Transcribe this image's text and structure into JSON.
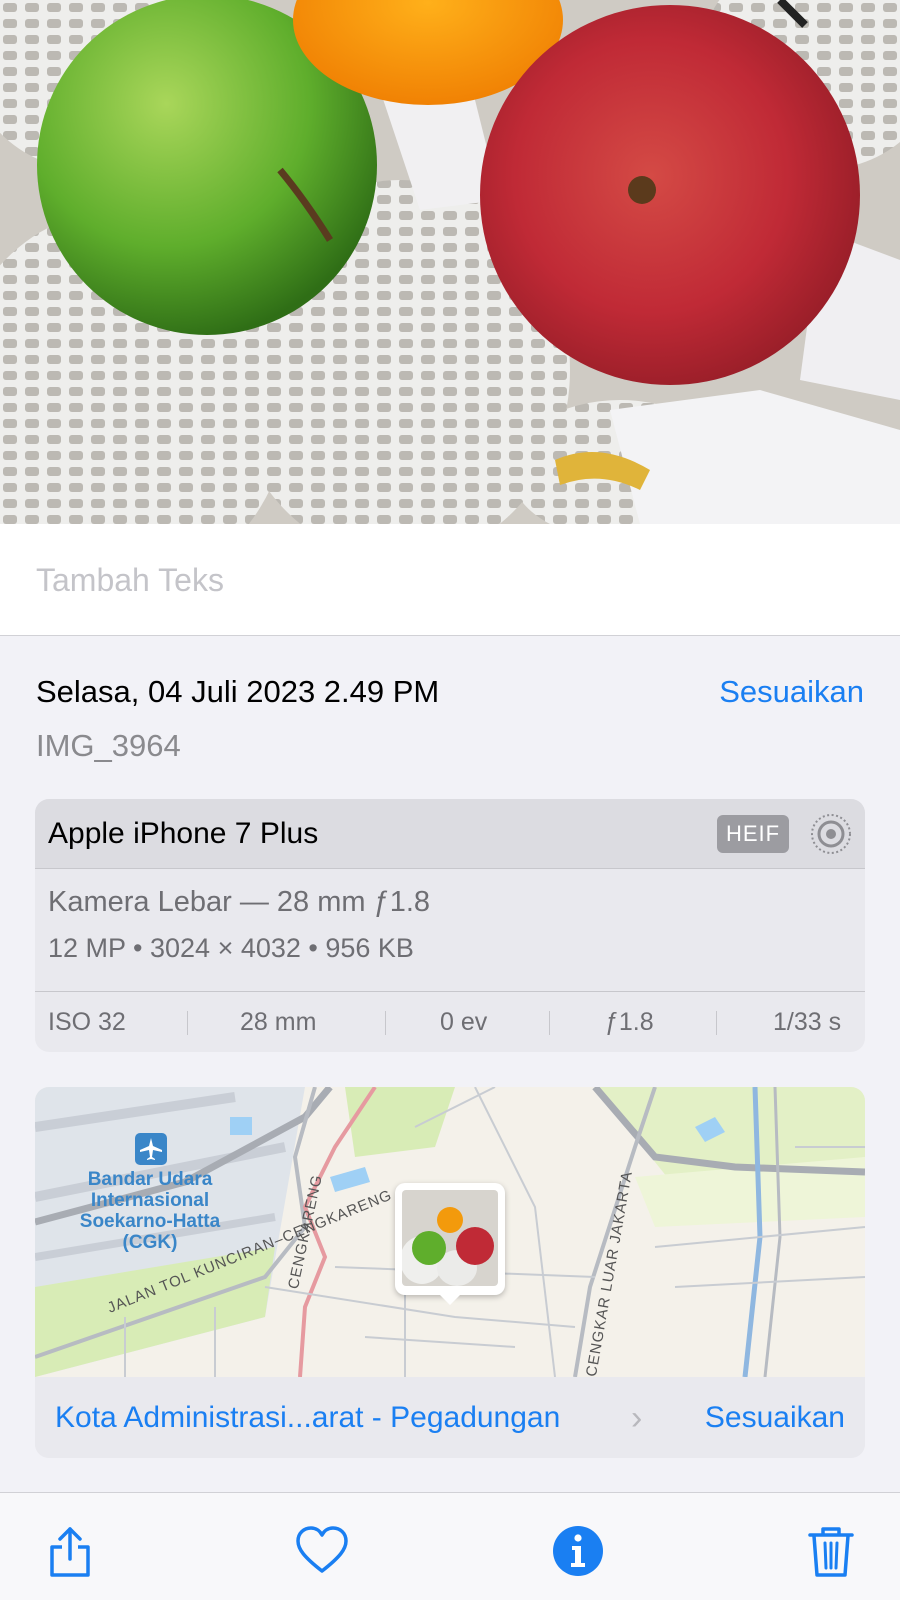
{
  "caption": {
    "placeholder": "Tambah Teks"
  },
  "header": {
    "date": "Selasa, 04 Juli 2023 2.49 PM",
    "adjust_label": "Sesuaikan",
    "filename": "IMG_3964"
  },
  "camera": {
    "device": "Apple iPhone 7 Plus",
    "format_badge": "HEIF",
    "lens": "Kamera Lebar — 28 mm ƒ1.8",
    "specs": "12 MP  •  3024 × 4032  •  956 KB",
    "exif": {
      "iso": "ISO 32",
      "focal": "28 mm",
      "ev": "0 ev",
      "aperture": "ƒ1.8",
      "shutter": "1/33 s"
    }
  },
  "map": {
    "airport_label": "Bandar Udara Internasional Soekarno-Hatta (CGK)",
    "road_1": "JALAN TOL KUNCIRAN–CENGKARENG",
    "road_2": "CENGKARENG",
    "road_3": "CENGKAR LUAR JAKARTA",
    "location": "Kota Administrasi...arat - Pegadungan",
    "adjust_label": "Sesuaikan"
  },
  "toolbar": {
    "icons": [
      "share-icon",
      "heart-icon",
      "info-icon",
      "trash-icon"
    ],
    "accent": "#1a7ff2"
  },
  "colors": {
    "accent": "#1a7ff2",
    "secondary_text": "#8a8a8e",
    "card_bg": "#e9e9ee"
  }
}
